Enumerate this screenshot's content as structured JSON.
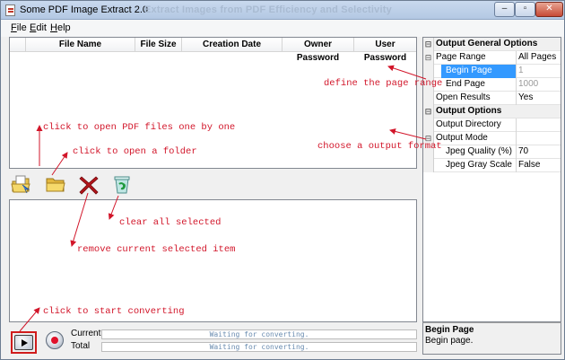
{
  "window": {
    "title": "Some PDF Image Extract 2.0",
    "subtitle": "Extract Images from PDF Efficiency and Selectivity",
    "minimize": "–",
    "maximize": "▫",
    "close": "✕"
  },
  "menu": [
    {
      "underline": "F",
      "rest": "ile"
    },
    {
      "underline": "E",
      "rest": "dit"
    },
    {
      "underline": "H",
      "rest": "elp"
    }
  ],
  "file_table": {
    "columns": [
      "File Name",
      "File Size",
      "Creation Date",
      "Owner Password",
      "User Password"
    ]
  },
  "toolbar": {
    "open_pdf_icon": "open-pdf-icon",
    "open_folder_icon": "folder-icon",
    "remove_icon": "red-x-icon",
    "clear_icon": "recycle-bin-icon"
  },
  "properties": {
    "general": {
      "category": "Output General Options",
      "toggle": "⊟",
      "page_range": {
        "name": "Page Range",
        "value": "All Pages",
        "toggle": "⊟"
      },
      "begin_page": {
        "name": "Begin Page",
        "value": "1"
      },
      "end_page": {
        "name": "End Page",
        "value": "1000"
      },
      "open_results": {
        "name": "Open Results",
        "value": "Yes"
      }
    },
    "output": {
      "category": "Output Options",
      "toggle": "⊟",
      "output_directory": {
        "name": "Output Directory",
        "value": ""
      },
      "output_mode": {
        "name": "Output Mode",
        "value": "",
        "toggle": "⊟"
      },
      "jpeg_quality": {
        "name": "Jpeg Quality (%)",
        "value": "70"
      },
      "jpeg_gray_scale": {
        "name": "Jpeg Gray Scale",
        "value": "False"
      }
    }
  },
  "description": {
    "title": "Begin Page",
    "text": "Begin page."
  },
  "progress": {
    "current_label": "Current",
    "current_status": "Waiting for converting.",
    "total_label": "Total",
    "total_status": "Waiting for converting."
  },
  "annotations": {
    "define_range": "define the page range",
    "open_pdf": "click to open PDF files one by one",
    "open_folder": "click to open a folder",
    "choose_format": "choose a output format",
    "clear_all": "clear all selected",
    "remove_item": "remove current selected item",
    "start_converting": "click to start converting"
  },
  "colors": {
    "annotation": "#d2162a",
    "selection": "#3399ff"
  }
}
